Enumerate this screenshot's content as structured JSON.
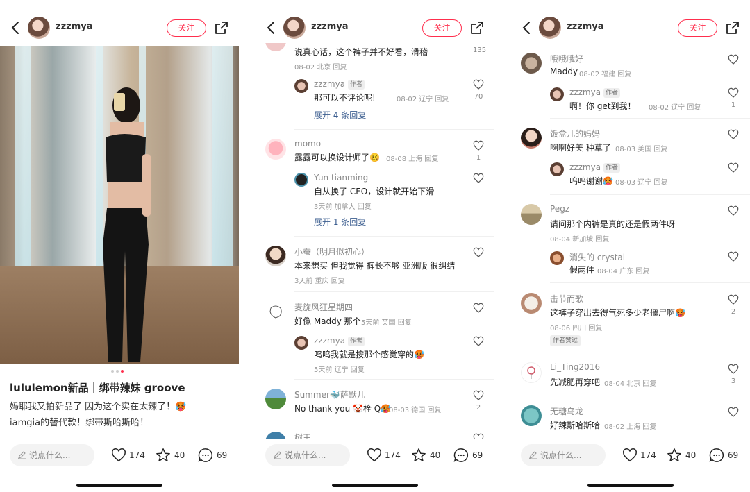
{
  "header": {
    "username": "zzzmya",
    "follow_label": "关注"
  },
  "post": {
    "title": "lululemon新品｜绑带辣妹 groove",
    "body_line1": "妈耶我又拍新品了 因为这个实在太辣了！🥵",
    "body_line2": "iamgia的替代款！绑带斯哈斯哈！"
  },
  "bottom": {
    "say_placeholder": "说点什么...",
    "likes": "174",
    "collects": "40",
    "comments": "69"
  },
  "icons": {
    "back": "chevron-left-icon",
    "share": "share-icon",
    "pen": "pen-icon",
    "heart": "heart-icon",
    "star": "star-icon",
    "comment": "comment-bubble-icon"
  },
  "colors": {
    "accent": "#ff2e4d",
    "link": "#3b5d8f"
  },
  "screen2": {
    "c1": {
      "text": "说真心话，这个裤子并不好看，滑稽",
      "meta": "08-02 北京 回复",
      "likes": "135"
    },
    "c1r": {
      "name": "zzzmya",
      "tag": "作者",
      "text": "那可以不评论呢!",
      "meta": "08-02 辽宁 回复",
      "likes": "70"
    },
    "c1x": "展开 4 条回复",
    "c2": {
      "name": "momo",
      "text": "露露可以换设计师了🥴",
      "meta": "08-08 上海 回复",
      "likes": "1"
    },
    "c2r": {
      "name": "Yun tianming",
      "text": "自从换了 CEO，设计就开始下滑",
      "meta": "3天前 加拿大 回复"
    },
    "c2x": "展开 1 条回复",
    "c3": {
      "name": "小蚕（明月似初心）",
      "text": "本来想买 但我觉得 裤长不够 亚洲版 很纠结",
      "meta": "3天前 重庆 回复"
    },
    "c4": {
      "name": "麦旋风狂星期四",
      "text": "好像 Maddy 那个",
      "meta": "5天前 英国 回复"
    },
    "c4r": {
      "name": "zzzmya",
      "tag": "作者",
      "text": "呜呜我就是按那个感觉穿的🥵",
      "meta": "5天前 辽宁 回复"
    },
    "c5": {
      "name": "Summer🐳萨默儿",
      "text": "No thank you 🤡栓 Q🥵",
      "meta": "08-03 德国 回复",
      "likes": "2"
    },
    "c6": {
      "name": "树王"
    }
  },
  "screen3": {
    "c1": {
      "name": "哦哦哦好",
      "text": "Maddy",
      "meta": "08-02 福建 回复"
    },
    "c1r": {
      "name": "zzzmya",
      "tag": "作者",
      "text": "啊！你 get到我！",
      "meta": "08-02 辽宁 回复",
      "likes": "1"
    },
    "c2": {
      "name": "饭盒儿的妈妈",
      "text": "啊啊好美 种草了",
      "meta": "08-03 美国 回复"
    },
    "c2r": {
      "name": "zzzmya",
      "tag": "作者",
      "text": "呜呜谢谢🥵",
      "meta": "08-03 辽宁 回复"
    },
    "c3": {
      "name": "Pegz",
      "text": "请问那个内裤是真的还是假两件呀",
      "meta": "08-04 新加坡 回复"
    },
    "c3r": {
      "name": "消失的 crystal",
      "text": "假两件",
      "meta": "08-04 广东 回复"
    },
    "c4": {
      "name": "击节而歌",
      "text": "这裤子穿出去得气死多少老僵尸啊🥵",
      "meta": "08-06 四川 回复",
      "likes": "2",
      "badge": "作者赞过"
    },
    "c5": {
      "name": "Li_Ting2016",
      "text": "先减肥再穿吧",
      "meta": "08-04 北京 回复",
      "likes": "3"
    },
    "c6": {
      "name": "无糖乌龙",
      "text": "好辣斯哈斯哈",
      "meta": "08-02 上海 回复"
    }
  }
}
